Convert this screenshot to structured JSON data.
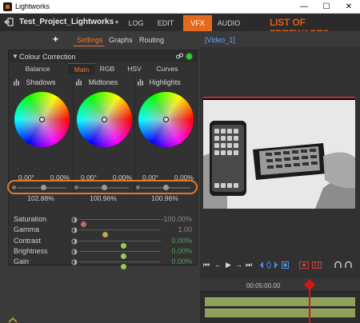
{
  "window": {
    "title": "Lightworks",
    "minimize": "—",
    "maximize": "☐",
    "close": "✕"
  },
  "menubar": {
    "project_name": "Test_Project_Lightworks",
    "project_caret": "▾",
    "tabs": [
      {
        "label": "LOG",
        "active": false
      },
      {
        "label": "EDIT",
        "active": false
      },
      {
        "label": "VFX",
        "active": true
      },
      {
        "label": "AUDIO",
        "active": false
      }
    ],
    "watermark": "LIST OF FREEWARES",
    "accent_color": "#e46a1e"
  },
  "subtabs": {
    "add": "+",
    "items": [
      "Settings",
      "Graphs",
      "Routing"
    ],
    "active": "Settings"
  },
  "colour_correction": {
    "header": "Colour Correction",
    "collapse_glyph": "▼",
    "tabs": [
      "Balance",
      "Main",
      "RGB",
      "HSV",
      "Curves"
    ],
    "active_tab": "Main",
    "wheels": [
      {
        "name": "Shadows",
        "hue": "0.00°",
        "sat": "0.00%",
        "level": "102.88%",
        "level_fraction": 0.55
      },
      {
        "name": "Midtones",
        "hue": "0.00°",
        "sat": "0.00%",
        "level": "100.96%",
        "level_fraction": 0.5
      },
      {
        "name": "Highlights",
        "hue": "0.00°",
        "sat": "0.00%",
        "level": "100.96%",
        "level_fraction": 0.5
      }
    ],
    "sliders": [
      {
        "label": "Saturation",
        "value": "-100.00%",
        "fraction": 0.02,
        "knob_color": "#c06a6a",
        "value_color": "#8a8a8a"
      },
      {
        "label": "Gamma",
        "value": "1.00",
        "fraction": 0.3,
        "knob_color": "#c8a050",
        "value_color": "#8a8a8a"
      },
      {
        "label": "Contrast",
        "value": "0.00%",
        "fraction": 0.55,
        "knob_color": "#9cc85a",
        "value_color": "#5a9a5a"
      },
      {
        "label": "Brightness",
        "value": "0.00%",
        "fraction": 0.55,
        "knob_color": "#9cc85a",
        "value_color": "#5a9a5a"
      },
      {
        "label": "Gain",
        "value": "0.00%",
        "fraction": 0.55,
        "knob_color": "#9cc85a",
        "value_color": "#5a9a5a"
      }
    ]
  },
  "viewer": {
    "clip_label": "[Video_1]"
  },
  "transport": {
    "buttons": [
      {
        "name": "jump-start-icon",
        "glyph": "⏮"
      },
      {
        "name": "step-back-icon",
        "glyph": "←"
      },
      {
        "name": "play-icon",
        "glyph": "▶"
      },
      {
        "name": "step-forward-icon",
        "glyph": "→"
      },
      {
        "name": "jump-end-icon",
        "glyph": "⏭"
      }
    ]
  },
  "timeline": {
    "timecode": "00:05:00.00"
  }
}
